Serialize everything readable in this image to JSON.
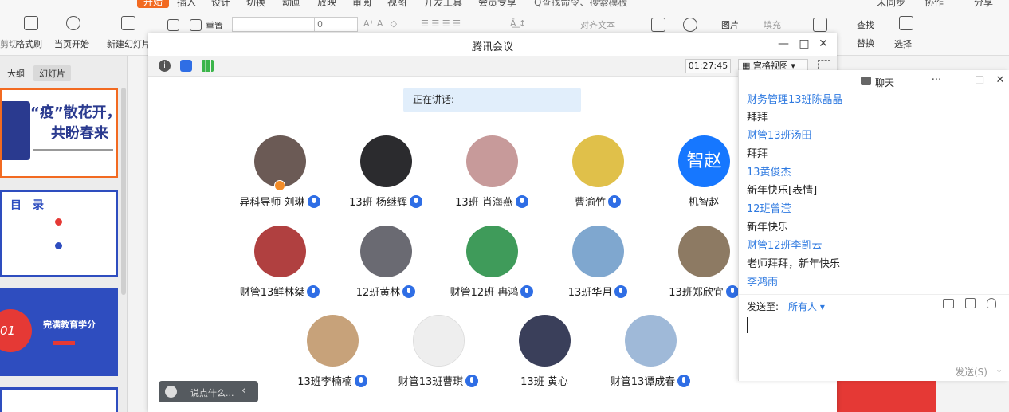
{
  "ribbon": {
    "tabs": [
      "开始",
      "插入",
      "设计",
      "切换",
      "动画",
      "放映",
      "审阅",
      "视图",
      "开发工具",
      "会员专享"
    ],
    "search": "Q查找命令、搜索模板",
    "sync": "未同步",
    "collab": "协作",
    "share": "分享",
    "cut": "剪切",
    "format_painter": "格式刷",
    "play_current": "当页开始",
    "new_slide": "新建幻灯片",
    "reset": "重置",
    "font_size": "0",
    "align_text": "对齐文本",
    "picture": "图片",
    "fill": "填充",
    "find": "查找",
    "replace": "替换",
    "select": "选择"
  },
  "left_panel": {
    "tab_outline": "大纲",
    "tab_slides": "幻灯片",
    "slide1_title_a": "“疫”散花开，",
    "slide1_title_b": "共盼春来",
    "slide2_title": "目　录",
    "slide3_number": "01",
    "slide3_title": "完满教育学分"
  },
  "meeting": {
    "title": "腾讯会议",
    "timer": "01:27:45",
    "view_mode": "宫格视图",
    "speaking": "正在讲话:",
    "say_placeholder": "说点什么...",
    "participants": [
      {
        "name": "异科导师 刘琳",
        "color": "#6b5a55"
      },
      {
        "name": "13班 杨继辉",
        "color": "#2b2b2e"
      },
      {
        "name": "13班 肖海燕",
        "color": "#c79a9a"
      },
      {
        "name": "曹渝竹",
        "color": "#e0c04a"
      },
      {
        "name": "机智赵",
        "avatar_text": "智赵",
        "color": "#1677ff"
      },
      {
        "name": "财管13鲜林桀",
        "color": "#b04040"
      },
      {
        "name": "12班黄林",
        "color": "#6a6a72"
      },
      {
        "name": "财管12班 冉鸿",
        "color": "#3f9b5a"
      },
      {
        "name": "13班华月",
        "color": "#7fa7cf"
      },
      {
        "name": "13班郑欣宜",
        "color": "#8d7a63"
      },
      {
        "name": "13班李楠楠",
        "color": "#c7a27a"
      },
      {
        "name": "财管13班曹琪",
        "color": "#eeeeee"
      },
      {
        "name": "13班 黄心",
        "color": "#3a3f5a"
      },
      {
        "name": "财管13谭成春",
        "color": "#9fb9d8"
      }
    ]
  },
  "chat": {
    "title": "聊天",
    "messages": [
      {
        "name": "财务管理13班陈晶晶",
        "text": "拜拜"
      },
      {
        "name": "财管13班汤田",
        "text": "拜拜"
      },
      {
        "name": "13黄俊杰",
        "text": "新年快乐[表情]"
      },
      {
        "name": "12班曾滢",
        "text": "新年快乐"
      },
      {
        "name": "财管12班李凯云",
        "text": "老师拜拜，新年快乐"
      },
      {
        "name": "李鸿雨",
        "text": ""
      }
    ],
    "send_to_label": "发送至:",
    "send_to_value": "所有人",
    "send_button": "发送(S)"
  }
}
